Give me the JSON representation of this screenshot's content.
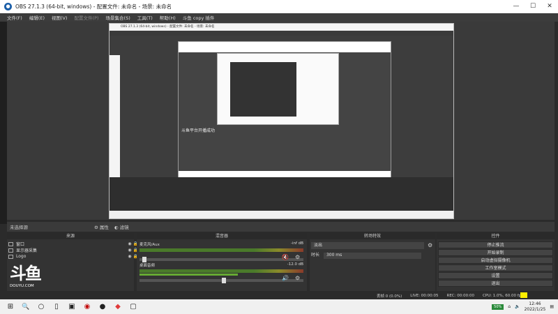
{
  "window": {
    "title": "OBS 27.1.3 (64-bit, windows) - 配置文件: 未命名 - 场景: 未命名"
  },
  "menu": {
    "items": [
      "文件(F)",
      "编辑(E)",
      "视图(V)",
      "配置文件(P)",
      "场景集合(S)",
      "工具(T)",
      "帮助(H)",
      "斗鱼 copy 插件"
    ]
  },
  "preview": {
    "toast": "斗鱼平台开播成功",
    "inner_title": "OBS 27.1.3 (64-bit, windows) - 配置文件: 未命名 - 场景: 未命名"
  },
  "scene_strip": {
    "label": "未选择源",
    "properties": "属性",
    "filters": "滤镜"
  },
  "docks": {
    "sources": "来源",
    "mixer": "混音器",
    "transitions": "转场特效",
    "controls": "控件"
  },
  "sources": [
    {
      "name": "窗口"
    },
    {
      "name": "显示器采集"
    },
    {
      "name": "Logo"
    }
  ],
  "mixer": {
    "tracks": [
      {
        "name": "麦克风/Aux",
        "db": "-inf dB",
        "level": 0.0
      },
      {
        "name": "桌面音频",
        "db": "-12.0 dB",
        "level": 0.55
      }
    ]
  },
  "transitions": {
    "selected": "淡出",
    "duration_label": "时长",
    "duration_value": "300 ms"
  },
  "controls": {
    "buttons": [
      "停止推流",
      "开始录制",
      "启动虚拟摄像机",
      "工作室模式",
      "设置",
      "退出"
    ]
  },
  "logo": {
    "text": "斗鱼",
    "domain": "DOUYU.COM"
  },
  "stats": {
    "dropped": "丢帧 0 (0.0%)",
    "live": "LIVE: 00:00:05",
    "rec": "REC: 00:00:00",
    "cpu": "CPU: 1.0%, 60.00 fps"
  },
  "taskbar": {
    "time": "12:46",
    "date": "2022/1/25",
    "cpu_badge": "50%"
  }
}
